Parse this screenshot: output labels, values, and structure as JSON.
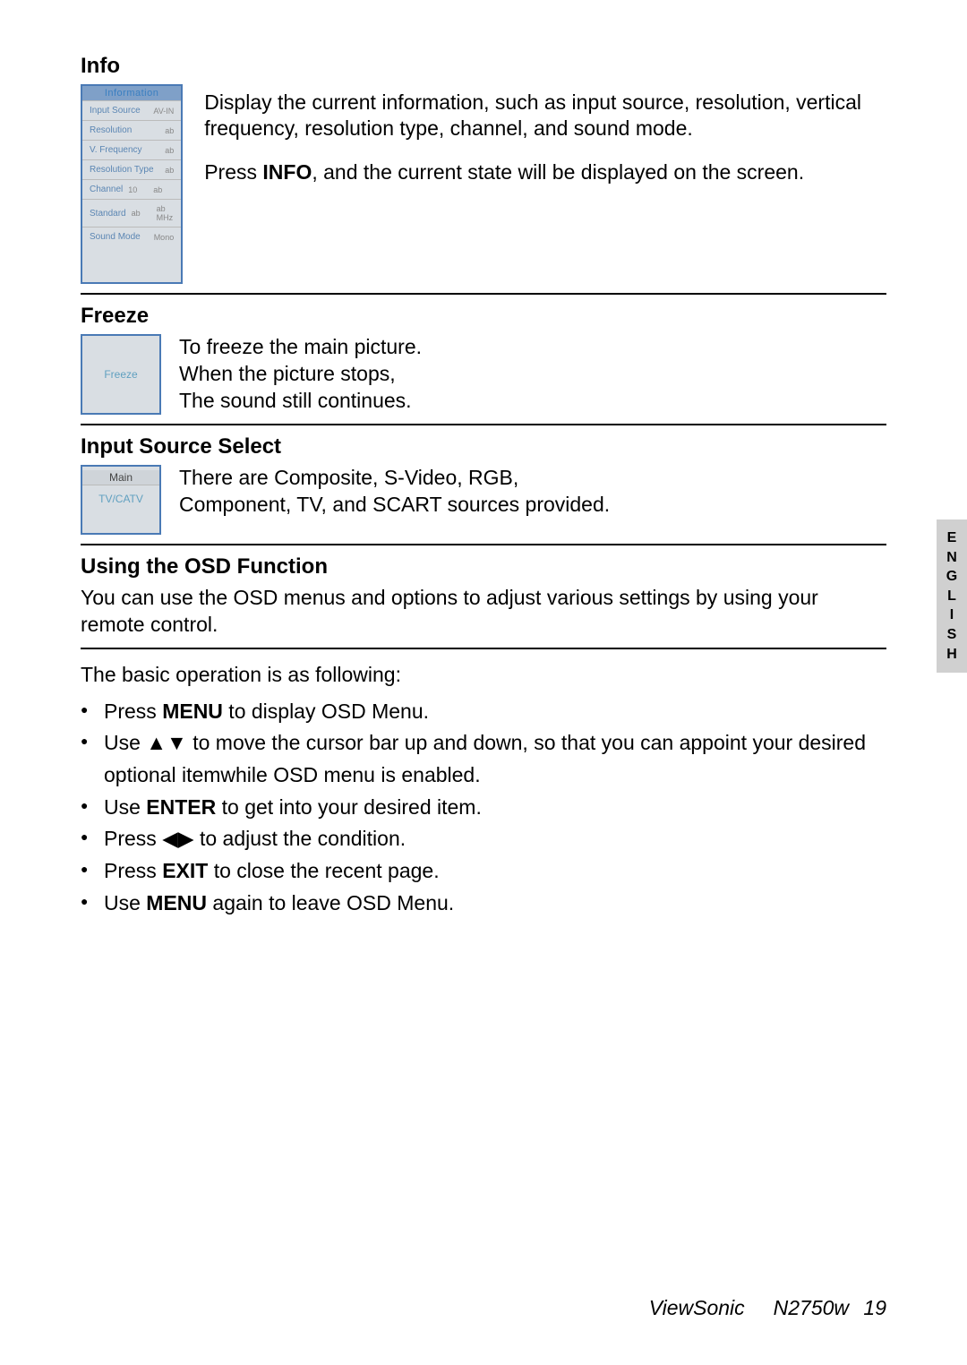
{
  "info": {
    "heading": "Info",
    "osd": {
      "title": "Information",
      "rows": [
        {
          "label": "Input Source",
          "value": "AV-IN"
        },
        {
          "label": "Resolution",
          "value": "ab"
        },
        {
          "label": "V. Frequency",
          "value": "ab"
        },
        {
          "label": "Resolution Type",
          "value": "ab"
        },
        {
          "label": "Channel",
          "mid": "10",
          "value": "ab"
        },
        {
          "label": "Standard",
          "mid": "ab",
          "value": "ab   MHz"
        },
        {
          "label": "Sound Mode",
          "value": "Mono"
        }
      ]
    },
    "para1": "Display the current information, such as input source, resolution, vertical frequency, resolution type, channel, and sound mode.",
    "para2_pre": "Press ",
    "para2_bold": "INFO",
    "para2_post": ", and the current state will be displayed on the screen."
  },
  "freeze": {
    "heading": "Freeze",
    "box_label": "Freeze",
    "line1": "To freeze the main picture.",
    "line2": "When the picture stops,",
    "line3": "The sound still continues."
  },
  "input_select": {
    "heading": "Input Source Select",
    "box_main": "Main",
    "box_sub": "TV/CATV",
    "line1": "There are Composite, S-Video, RGB,",
    "line2": "Component, TV, and SCART sources provided."
  },
  "osd_func": {
    "heading": "Using the OSD Function",
    "para": "You can use the OSD menus and options to adjust various settings by using your remote control.",
    "intro": "The basic operation is as following:",
    "b1_pre": "Press ",
    "b1_bold": "MENU",
    "b1_post": " to display OSD Menu.",
    "b2_pre": "Use ",
    "b2_symbols": "▲▼",
    "b2_post": " to move the cursor bar up and down, so that you can appoint your desired optional itemwhile OSD menu is enabled.",
    "b3_pre": "Use ",
    "b3_bold": "ENTER",
    "b3_post": " to get into your desired item.",
    "b4_pre": "Press ",
    "b4_symbols": "◀▶",
    "b4_post": " to adjust the condition.",
    "b5_pre": "Press ",
    "b5_bold": "EXIT",
    "b5_post": " to close the recent page.",
    "b6_pre": "Use ",
    "b6_bold": "MENU",
    "b6_post": " again to leave OSD Menu."
  },
  "side_tab": "ENGLISH",
  "footer": {
    "brand": "ViewSonic",
    "model": "N2750w",
    "page": "19"
  }
}
